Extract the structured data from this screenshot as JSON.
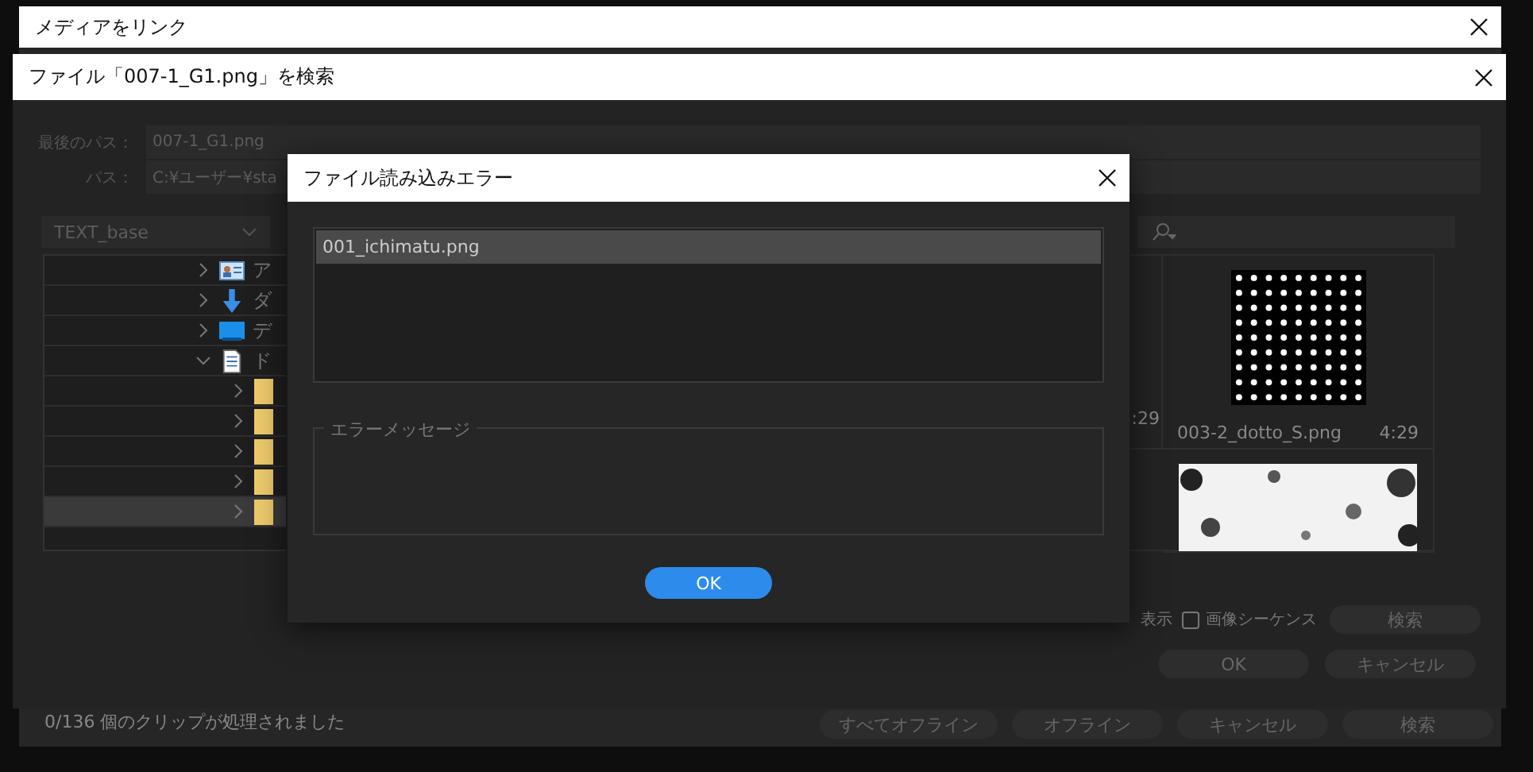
{
  "link_window": {
    "title": "メディアをリンク",
    "status": "0/136 個のクリップが処理されました",
    "buttons": [
      "すべてオフライン",
      "オフライン",
      "キャンセル",
      "検索"
    ]
  },
  "search_window": {
    "title": "ファイル「007-1_G1.png」を検索",
    "last_path": {
      "label": "最後のパス：",
      "value": "007-1_G1.png"
    },
    "path": {
      "label": "パス：",
      "value": "C:¥ユーザー¥sta"
    },
    "location_dropdown": "TEXT_base",
    "tree": [
      {
        "kind": "contact",
        "label": "ア",
        "expanded": false,
        "selected": false
      },
      {
        "kind": "download",
        "label": "ダ",
        "expanded": false,
        "selected": false
      },
      {
        "kind": "desktop",
        "label": "デ",
        "expanded": false,
        "selected": false
      },
      {
        "kind": "document",
        "label": "ド",
        "expanded": true,
        "selected": false,
        "children": [
          {
            "kind": "folder",
            "expanded": false,
            "selected": false
          },
          {
            "kind": "folder",
            "expanded": false,
            "selected": false
          },
          {
            "kind": "folder",
            "expanded": false,
            "selected": false
          },
          {
            "kind": "folder",
            "expanded": false,
            "selected": false
          },
          {
            "kind": "folder",
            "expanded": false,
            "selected": true
          }
        ]
      }
    ],
    "thumbnails": [
      {
        "kind": "cut",
        "duration": ":29"
      },
      {
        "kind": "dots",
        "name": "003-2_dotto_S.png",
        "duration": "4:29"
      },
      {
        "kind": "noise"
      }
    ],
    "checkboxes": [
      {
        "label": "表示"
      },
      {
        "label": "画像シーケンス",
        "checked": false
      }
    ],
    "search_button": "検索",
    "ok_button": "OK",
    "cancel_button": "キャンセル"
  },
  "error_dialog": {
    "title": "ファイル読み込みエラー",
    "files": [
      {
        "name": "001_ichimatu.png",
        "selected": true
      }
    ],
    "message_group": "エラーメッセージ",
    "ok_button": "OK"
  }
}
